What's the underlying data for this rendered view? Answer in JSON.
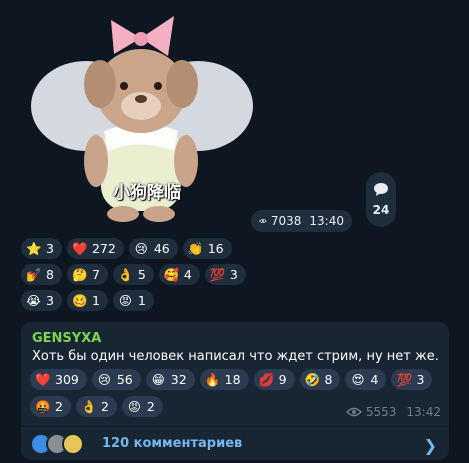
{
  "sticker": {
    "caption": "小狗降临",
    "views": "7038",
    "time": "13:40"
  },
  "comments_count": "24",
  "top_reactions": [
    [
      {
        "emoji": "⭐",
        "count": "3"
      },
      {
        "emoji": "❤️",
        "count": "272"
      },
      {
        "emoji": "😢",
        "count": "46"
      },
      {
        "emoji": "👏",
        "count": "16"
      }
    ],
    [
      {
        "emoji": "💅",
        "count": "8"
      },
      {
        "emoji": "🤔",
        "count": "7"
      },
      {
        "emoji": "👌",
        "count": "5"
      },
      {
        "emoji": "🥰",
        "count": "4"
      },
      {
        "emoji": "💯",
        "count": "3"
      }
    ],
    [
      {
        "emoji": "😭",
        "count": "3"
      },
      {
        "emoji": "🥴",
        "count": "1"
      },
      {
        "emoji": "😡",
        "count": "1"
      }
    ]
  ],
  "post": {
    "author": "GENSYXA",
    "text": "Хоть бы один человек написал что ждет стрим, ну нет же.",
    "views": "5553",
    "time": "13:42",
    "reactions": [
      [
        {
          "emoji": "❤️",
          "count": "309"
        },
        {
          "emoji": "😢",
          "count": "56"
        },
        {
          "emoji": "😁",
          "count": "32"
        },
        {
          "emoji": "🔥",
          "count": "18"
        },
        {
          "emoji": "💋",
          "count": "9"
        },
        {
          "emoji": "🤣",
          "count": "8"
        },
        {
          "emoji": "😍",
          "count": "4"
        },
        {
          "emoji": "💯",
          "count": "3"
        }
      ],
      [
        {
          "emoji": "🤬",
          "count": "2"
        },
        {
          "emoji": "👌",
          "count": "2"
        },
        {
          "emoji": "😡",
          "count": "2"
        }
      ]
    ],
    "comments_label": "120 комментариев"
  },
  "colors": {
    "background": "#0e1621",
    "bubble": "#182533",
    "chip": "#1f2e3c",
    "author": "#7ed44c",
    "link": "#75b6ec",
    "meta": "#6d7f8f"
  }
}
